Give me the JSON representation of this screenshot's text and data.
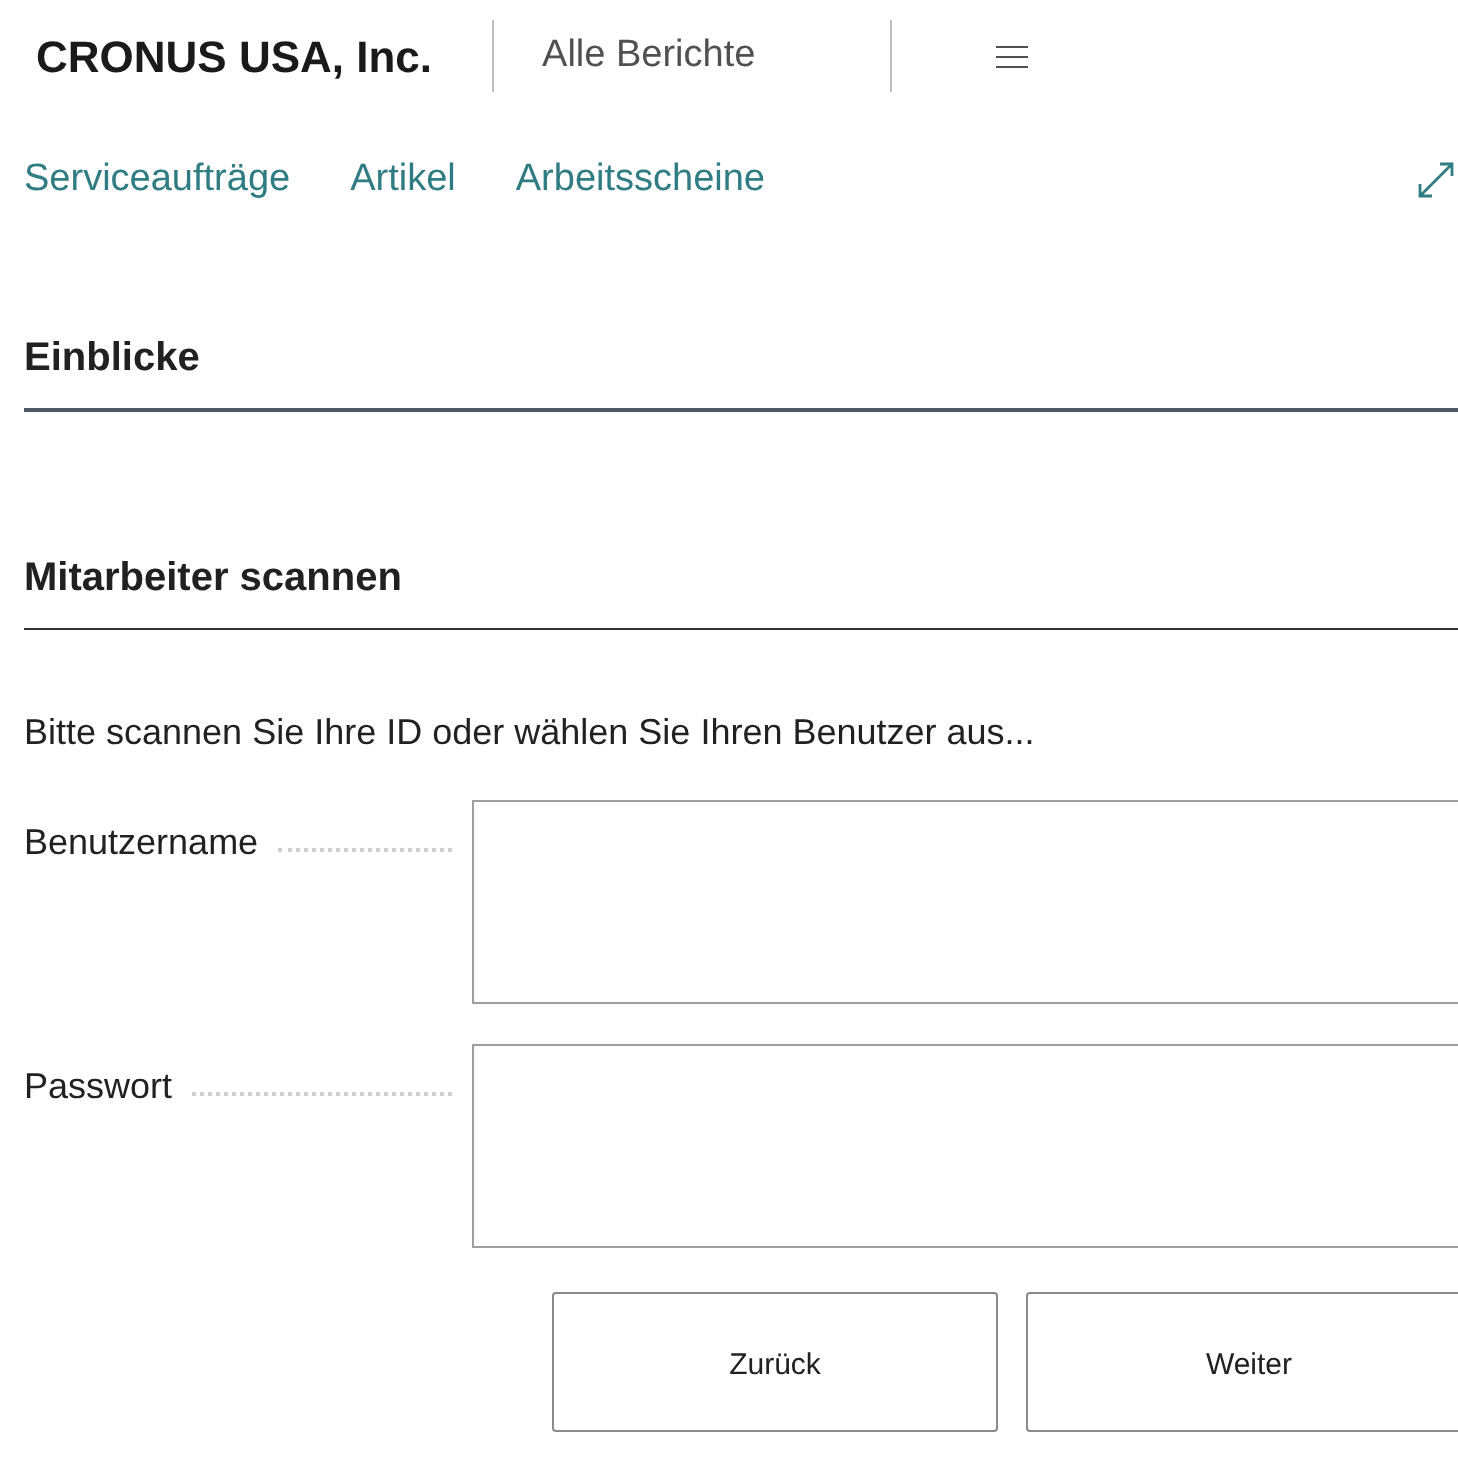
{
  "header": {
    "company": "CRONUS USA, Inc.",
    "reports_link": "Alle Berichte"
  },
  "nav": [
    "Serviceaufträge",
    "Artikel",
    "Arbeitsscheine"
  ],
  "sections": [
    "Einblicke",
    "Mitarbeiter scannen"
  ],
  "instruction": "Bitte scannen Sie Ihre ID oder wählen Sie Ihren Benutzer aus...",
  "fields": [
    {
      "label": "Benutzername"
    },
    {
      "label": "Passwort"
    }
  ],
  "buttons": [
    "Zurück",
    "Weiter"
  ]
}
